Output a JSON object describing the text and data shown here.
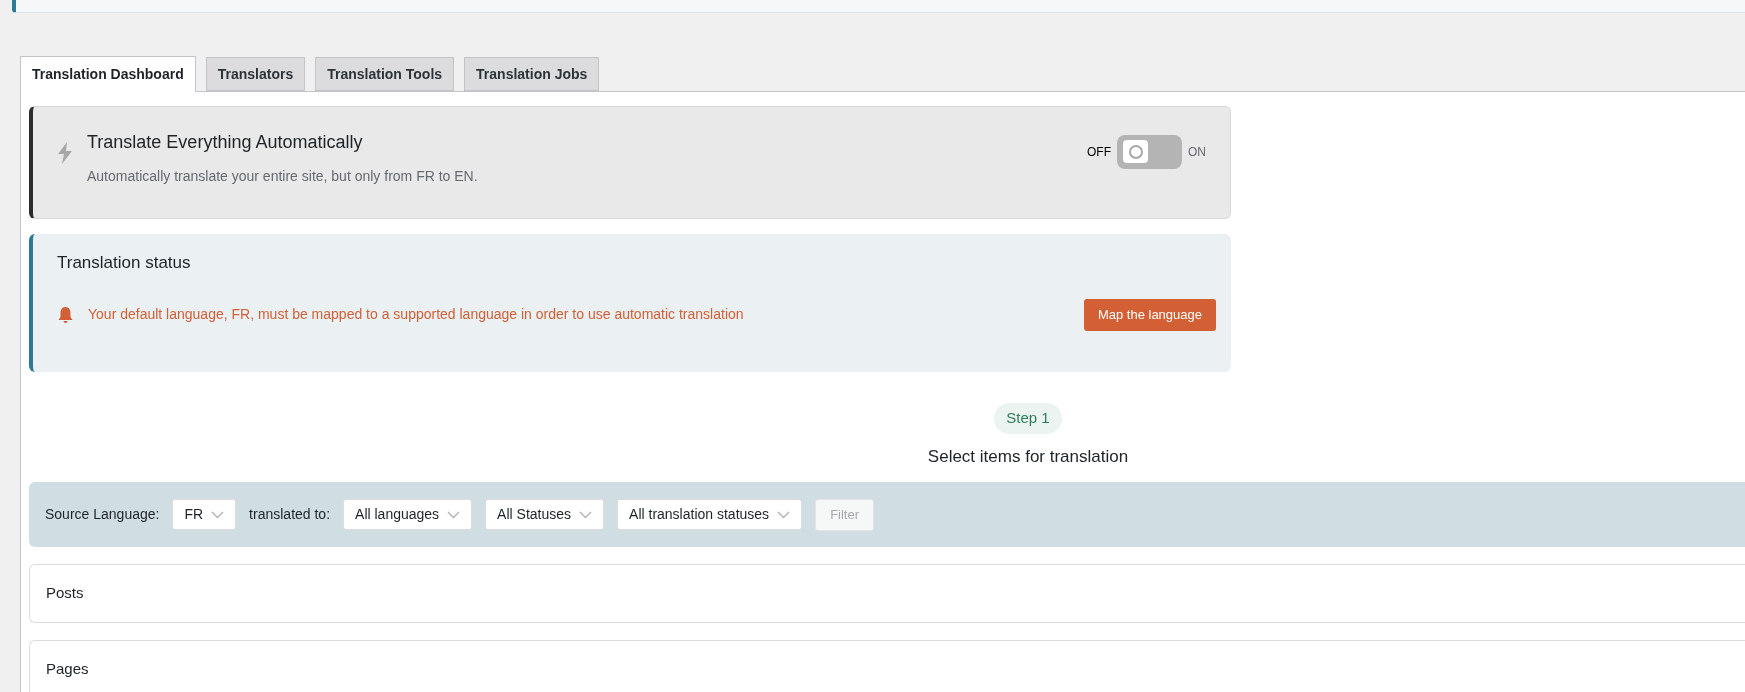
{
  "tabs": [
    {
      "label": "Translation Dashboard",
      "selected": true
    },
    {
      "label": "Translators",
      "selected": false
    },
    {
      "label": "Translation Tools",
      "selected": false
    },
    {
      "label": "Translation Jobs",
      "selected": false
    }
  ],
  "auto_translate": {
    "title": "Translate Everything Automatically",
    "description": "Automatically translate your entire site, but only from FR to EN.",
    "off_label": "OFF",
    "on_label": "ON",
    "on": false
  },
  "translation_status": {
    "title": "Translation status",
    "message": "Your default language, FR, must be mapped to a supported language in order to use automatic translation",
    "button": "Map the language"
  },
  "step": {
    "badge": "Step 1",
    "title": "Select items for translation"
  },
  "filters": {
    "source_label": "Source Language:",
    "source_value": "FR",
    "target_label": "translated to:",
    "dropdowns": [
      "All languages",
      "All Statuses",
      "All translation statuses"
    ],
    "button": "Filter",
    "button_disabled": true
  },
  "sections": [
    "Posts",
    "Pages"
  ]
}
